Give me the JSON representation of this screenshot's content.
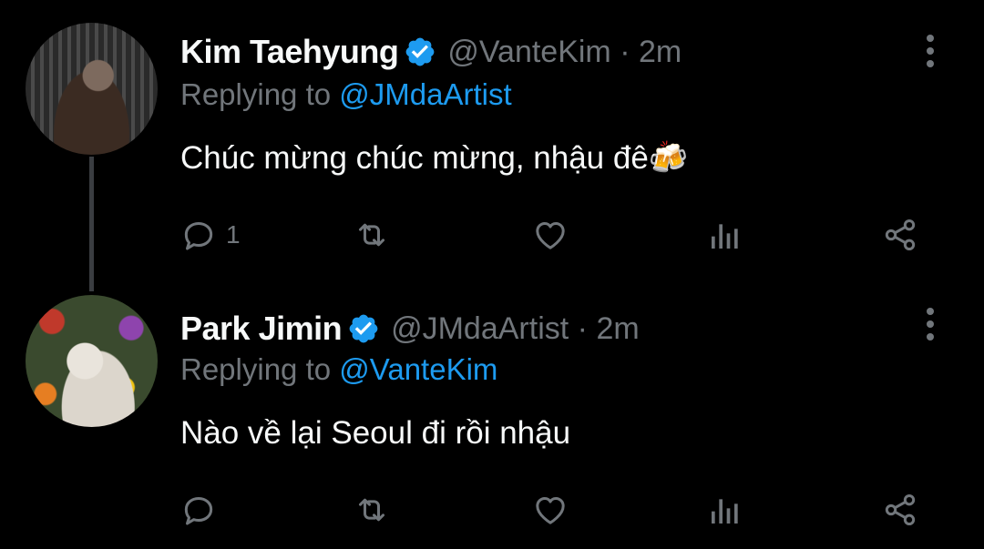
{
  "colors": {
    "background": "#000000",
    "text": "#f7f9f9",
    "muted": "#71767b",
    "link": "#1d9bf0",
    "thread_line": "#3a3d41"
  },
  "tweets": [
    {
      "name": "Kim Taehyung",
      "handle": "@VanteKim",
      "separator": "·",
      "time": "2m",
      "replying_prefix": "Replying to",
      "replying_handle": "@JMdaArtist",
      "text": "Chúc mừng chúc mừng, nhậu đê🍻",
      "reply_count": "1",
      "icons": [
        "reply-icon",
        "retweet-icon",
        "like-icon",
        "analytics-icon",
        "share-icon",
        "more-icon"
      ]
    },
    {
      "name": "Park Jimin",
      "handle": "@JMdaArtist",
      "separator": "·",
      "time": "2m",
      "replying_prefix": "Replying to",
      "replying_handle": "@VanteKim",
      "text": "Nào về lại Seoul đi rồi nhậu",
      "reply_count": "",
      "icons": [
        "reply-icon",
        "retweet-icon",
        "like-icon",
        "analytics-icon",
        "share-icon",
        "more-icon"
      ]
    }
  ]
}
